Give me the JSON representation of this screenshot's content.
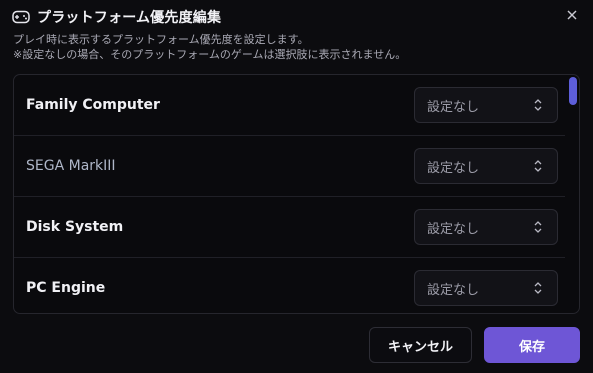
{
  "dialog": {
    "title": "プラットフォーム優先度編集",
    "description_line1": "プレイ時に表示するプラットフォーム優先度を設定します。",
    "description_line2": "※設定なしの場合、そのプラットフォームのゲームは選択肢に表示されません。",
    "close_icon": "close-icon",
    "title_icon": "gamepad-icon"
  },
  "platforms": [
    {
      "name": "Family Computer",
      "priority": "設定なし",
      "muted": false
    },
    {
      "name": "SEGA MarkIII",
      "priority": "設定なし",
      "muted": true
    },
    {
      "name": "Disk System",
      "priority": "設定なし",
      "muted": false
    },
    {
      "name": "PC Engine",
      "priority": "設定なし",
      "muted": false
    }
  ],
  "footer": {
    "cancel_label": "キャンセル",
    "save_label": "保存"
  },
  "colors": {
    "accent": "#6e56d6",
    "scroll_thumb": "#5d5ed9",
    "background": "#0c0c0f"
  }
}
